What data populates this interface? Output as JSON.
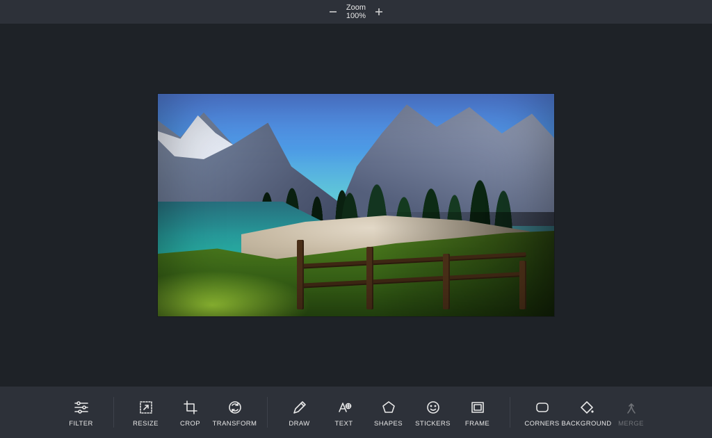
{
  "zoom": {
    "label": "Zoom",
    "value": "100%"
  },
  "toolbar": {
    "filter": "FILTER",
    "resize": "RESIZE",
    "crop": "CROP",
    "transform": "TRANSFORM",
    "draw": "DRAW",
    "text": "TEXT",
    "shapes": "SHAPES",
    "stickers": "STICKERS",
    "frame": "FRAME",
    "corners": "CORNERS",
    "background": "BACKGROUND",
    "merge": "MERGE"
  }
}
